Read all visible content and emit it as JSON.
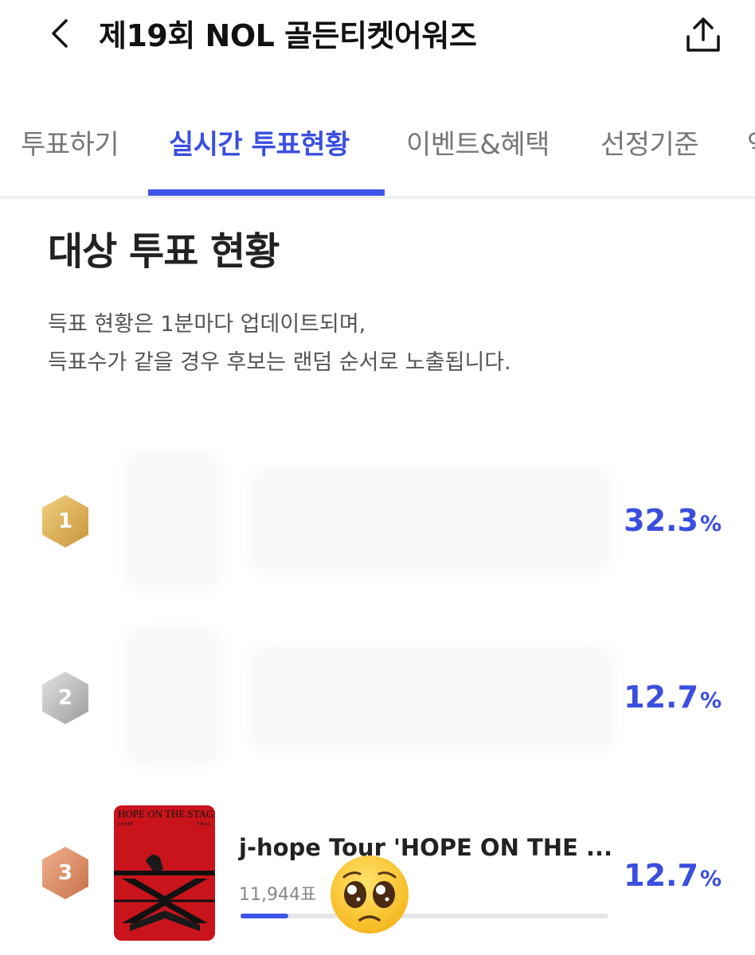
{
  "header": {
    "back_icon": "chevron-left-icon",
    "title": "제19회 NOL 골든티켓어워즈",
    "share_icon": "share-icon"
  },
  "tabs": [
    {
      "label": "투표하기",
      "active": false
    },
    {
      "label": "실시간 투표현황",
      "active": true
    },
    {
      "label": "이벤트&혜택",
      "active": false
    },
    {
      "label": "선정기준",
      "active": false
    },
    {
      "label": "역",
      "active": false
    }
  ],
  "section": {
    "title": "대상 투표 현황",
    "notice_line1": "득표 현황은 1분마다 업데이트되며,",
    "notice_line2": "득표수가 같을 경우 후보는 랜덤 순서로 노출됩니다."
  },
  "rankings": [
    {
      "rank": "1",
      "medal": "gold",
      "percent": "32.3",
      "unit": "%"
    },
    {
      "rank": "2",
      "medal": "silver",
      "percent": "12.7",
      "unit": "%"
    },
    {
      "rank": "3",
      "medal": "bronze",
      "percent": "12.7",
      "unit": "%",
      "name": "j-hope Tour 'HOPE ON THE ...",
      "votes": "11,944표",
      "progress": 0.13,
      "album_text": "HOPE ON THE STAGE",
      "album_subtext": "j-HOPE",
      "album_subtext2": "FINAL"
    }
  ],
  "sticker": {
    "icon": "pleading-face-emoji-icon"
  },
  "colors": {
    "accent": "#3e55ea",
    "gold": "#d9a84e",
    "silver": "#b5b5b5",
    "bronze": "#d98a63",
    "album_red": "#c9141c"
  }
}
